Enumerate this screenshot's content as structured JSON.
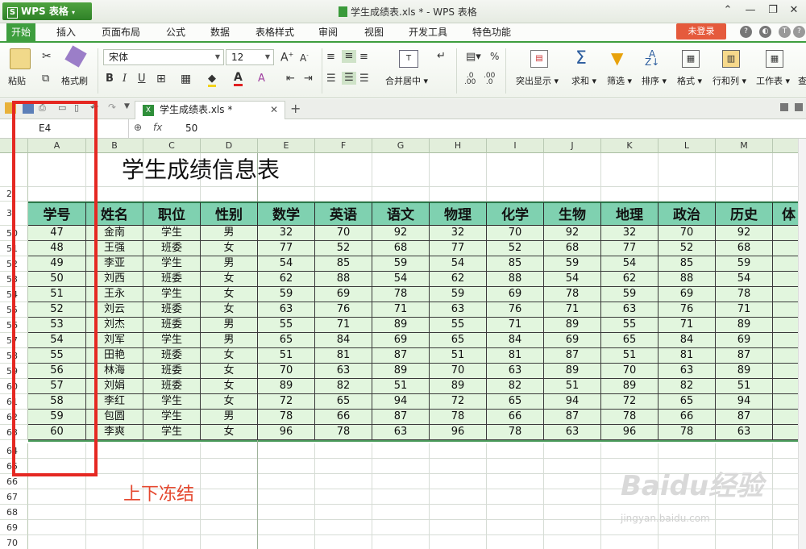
{
  "app": {
    "name": "WPS 表格",
    "logo": "S"
  },
  "window": {
    "title": "学生成绩表.xls * - WPS 表格"
  },
  "menu": {
    "items": [
      "开始",
      "插入",
      "页面布局",
      "公式",
      "数据",
      "表格样式",
      "审阅",
      "视图",
      "开发工具",
      "特色功能"
    ],
    "active": "开始",
    "login": "未登录"
  },
  "ribbon": {
    "paste": "粘贴",
    "format_painter": "格式刷",
    "font": "宋体",
    "size": "12",
    "merge_center": "合并居中",
    "highlight": "突出显示",
    "sum": "求和",
    "filter": "筛选",
    "sort": "排序",
    "format": "格式",
    "rowcol": "行和列",
    "sheet": "工作表",
    "more": "查"
  },
  "doc_tab": {
    "name": "学生成绩表.xls *"
  },
  "formula_bar": {
    "cell_ref": "E4",
    "fx": "fx",
    "value": "50"
  },
  "columns": [
    "A",
    "B",
    "C",
    "D",
    "E",
    "F",
    "G",
    "H",
    "I",
    "J",
    "K",
    "L",
    "M"
  ],
  "sheet_title": "学生成绩信息表",
  "table": {
    "headers": [
      "学号",
      "姓名",
      "职位",
      "性别",
      "数学",
      "英语",
      "语文",
      "物理",
      "化学",
      "生物",
      "地理",
      "政治",
      "历史",
      "体"
    ],
    "rows": [
      [
        "47",
        "金南",
        "学生",
        "男",
        "32",
        "70",
        "92",
        "32",
        "70",
        "92",
        "32",
        "70",
        "92"
      ],
      [
        "48",
        "王强",
        "班委",
        "女",
        "77",
        "52",
        "68",
        "77",
        "52",
        "68",
        "77",
        "52",
        "68"
      ],
      [
        "49",
        "李亚",
        "学生",
        "男",
        "54",
        "85",
        "59",
        "54",
        "85",
        "59",
        "54",
        "85",
        "59"
      ],
      [
        "50",
        "刘西",
        "班委",
        "女",
        "62",
        "88",
        "54",
        "62",
        "88",
        "54",
        "62",
        "88",
        "54"
      ],
      [
        "51",
        "王永",
        "学生",
        "女",
        "59",
        "69",
        "78",
        "59",
        "69",
        "78",
        "59",
        "69",
        "78"
      ],
      [
        "52",
        "刘云",
        "班委",
        "女",
        "63",
        "76",
        "71",
        "63",
        "76",
        "71",
        "63",
        "76",
        "71"
      ],
      [
        "53",
        "刘杰",
        "班委",
        "男",
        "55",
        "71",
        "89",
        "55",
        "71",
        "89",
        "55",
        "71",
        "89"
      ],
      [
        "54",
        "刘军",
        "学生",
        "男",
        "65",
        "84",
        "69",
        "65",
        "84",
        "69",
        "65",
        "84",
        "69"
      ],
      [
        "55",
        "田艳",
        "班委",
        "女",
        "51",
        "81",
        "87",
        "51",
        "81",
        "87",
        "51",
        "81",
        "87"
      ],
      [
        "56",
        "林海",
        "班委",
        "女",
        "70",
        "63",
        "89",
        "70",
        "63",
        "89",
        "70",
        "63",
        "89"
      ],
      [
        "57",
        "刘娟",
        "班委",
        "女",
        "89",
        "82",
        "51",
        "89",
        "82",
        "51",
        "89",
        "82",
        "51"
      ],
      [
        "58",
        "李红",
        "学生",
        "女",
        "72",
        "65",
        "94",
        "72",
        "65",
        "94",
        "72",
        "65",
        "94"
      ],
      [
        "59",
        "包圆",
        "学生",
        "男",
        "78",
        "66",
        "87",
        "78",
        "66",
        "87",
        "78",
        "66",
        "87"
      ],
      [
        "60",
        "李爽",
        "学生",
        "女",
        "96",
        "78",
        "63",
        "96",
        "78",
        "63",
        "96",
        "78",
        "63"
      ]
    ]
  },
  "row_numbers": {
    "top": [
      "",
      "2",
      "3"
    ],
    "data": [
      "50",
      "51",
      "52",
      "53",
      "54",
      "55",
      "56",
      "57",
      "58",
      "59",
      "60",
      "61",
      "62",
      "63"
    ],
    "bottom": [
      "64",
      "65",
      "66",
      "67",
      "68",
      "69",
      "70"
    ]
  },
  "annotation": "上下冻结",
  "watermark": {
    "brand": "Baidu经验",
    "url": "jingyan.baidu.com"
  }
}
